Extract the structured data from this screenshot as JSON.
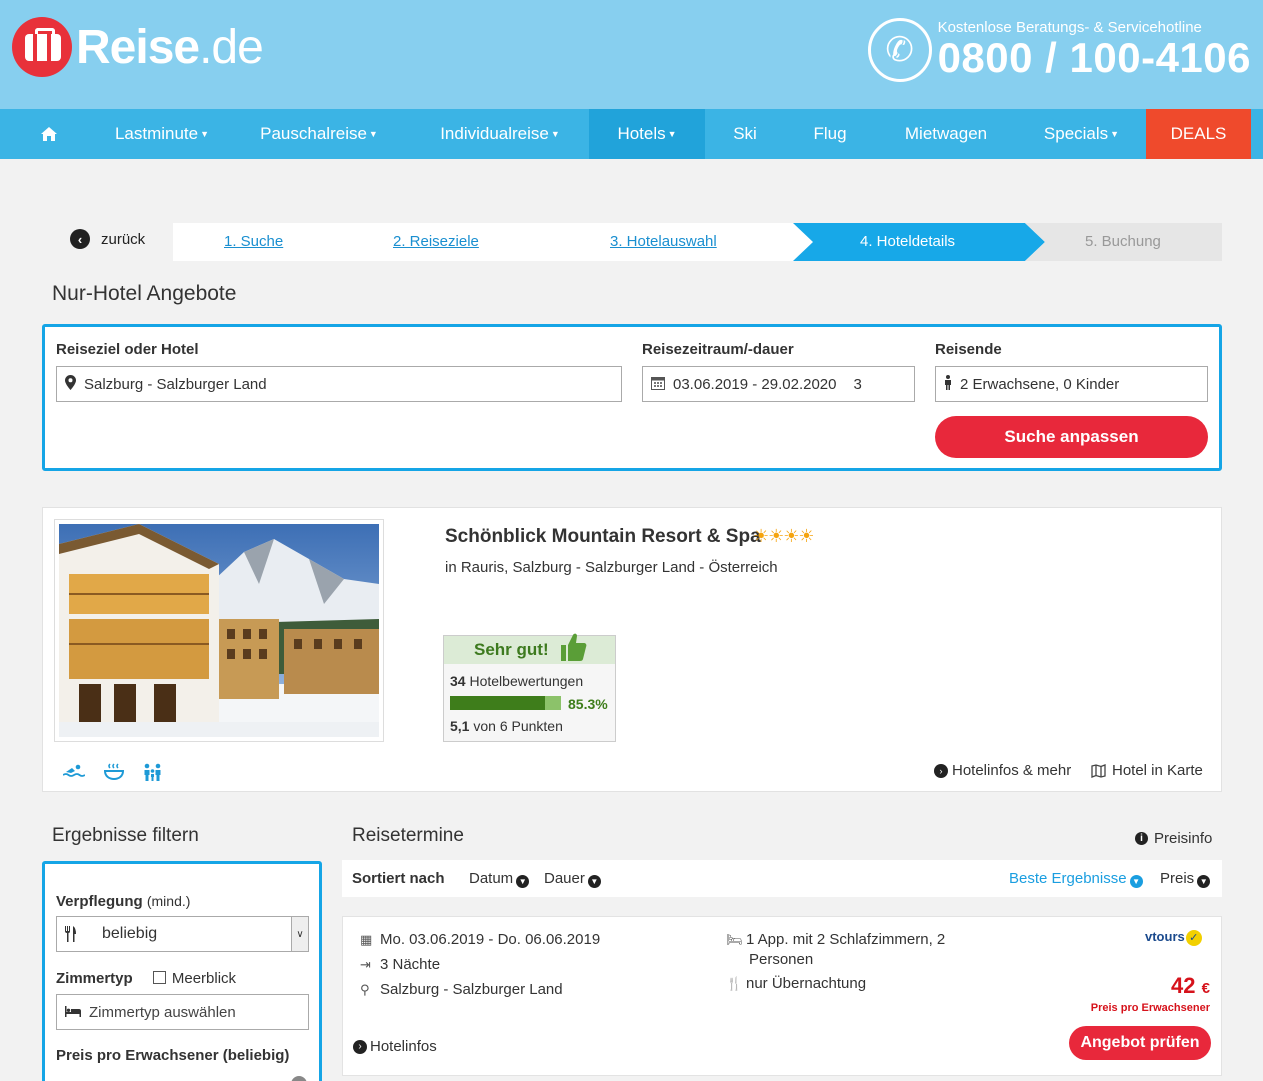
{
  "header": {
    "logo_main": "Reise",
    "logo_tld": ".de",
    "hotline_label": "Kostenlose Beratungs- & Servicehotline",
    "hotline_number": "0800 / 100-4106"
  },
  "nav": {
    "items": [
      {
        "label": "Lastminute",
        "dropdown": true
      },
      {
        "label": "Pauschalreise",
        "dropdown": true
      },
      {
        "label": "Individualreise",
        "dropdown": true
      },
      {
        "label": "Hotels",
        "dropdown": true,
        "active": true
      },
      {
        "label": "Ski",
        "dropdown": false
      },
      {
        "label": "Flug",
        "dropdown": false
      },
      {
        "label": "Mietwagen",
        "dropdown": false
      },
      {
        "label": "Specials",
        "dropdown": true
      },
      {
        "label": "DEALS",
        "dropdown": false
      }
    ]
  },
  "steps": {
    "back_label": "zurück",
    "items": [
      "1. Suche",
      "2. Reiseziele",
      "3. Hotelauswahl",
      "4. Hoteldetails",
      "5. Buchung"
    ]
  },
  "page_title": "Nur-Hotel Angebote",
  "search": {
    "destination_label": "Reiseziel oder Hotel",
    "destination_value": "Salzburg - Salzburger Land",
    "period_label": "Reisezeitraum/-dauer",
    "period_value": "03.06.2019 - 29.02.2020",
    "duration_value": "3",
    "travelers_label": "Reisende",
    "travelers_value": "2 Erwachsene, 0 Kinder",
    "submit_label": "Suche anpassen"
  },
  "hotel": {
    "name": "Schönblick Mountain Resort & Spa",
    "stars": "☀☀☀☀",
    "location": "in Rauris, Salzburg - Salzburger Land - Österreich",
    "rating_label": "Sehr gut!",
    "reviews_count": "34",
    "reviews_label": "Hotelbewertungen",
    "rating_percent": "85.3%",
    "recommend_fraction": 0.853,
    "score": "5,1",
    "score_label": "von 6 Punkten",
    "link_info": "Hotelinfos & mehr",
    "link_map": "Hotel in Karte"
  },
  "filter": {
    "title": "Ergebnisse filtern",
    "board_label": "Verpflegung",
    "board_qualifier": "(mind.)",
    "board_value": "beliebig",
    "room_label": "Zimmertyp",
    "seaview_label": "Meerblick",
    "room_placeholder": "Zimmertyp auswählen",
    "price_label": "Preis pro Erwachsener",
    "price_qualifier": "(beliebig)"
  },
  "results": {
    "title": "Reisetermine",
    "priceinfo_label": "Preisinfo",
    "sort_label": "Sortiert nach",
    "sort_date": "Datum",
    "sort_duration": "Dauer",
    "sort_best": "Beste Ergebnisse",
    "sort_price": "Preis",
    "offer": {
      "dates": "Mo. 03.06.2019 - Do. 06.06.2019",
      "nights": "3 Nächte",
      "region": "Salzburg - Salzburger Land",
      "room_line1": "1 App. mit 2 Schlafzimmern, 2",
      "room_line2": "Personen",
      "board": "nur Übernachtung",
      "operator": "vtours",
      "price": "42",
      "currency": "€",
      "price_note": "Preis pro Erwachsener",
      "hotelinfo_label": "Hotelinfos",
      "cta_label": "Angebot prüfen"
    }
  },
  "colors": {
    "header_bg": "#87cfef",
    "nav_bg": "#3bb4e5",
    "accent_blue": "#15a5e6",
    "cta_red": "#e8283b",
    "deals_orange": "#ef4a2c",
    "rating_green": "#3e7d1b"
  }
}
